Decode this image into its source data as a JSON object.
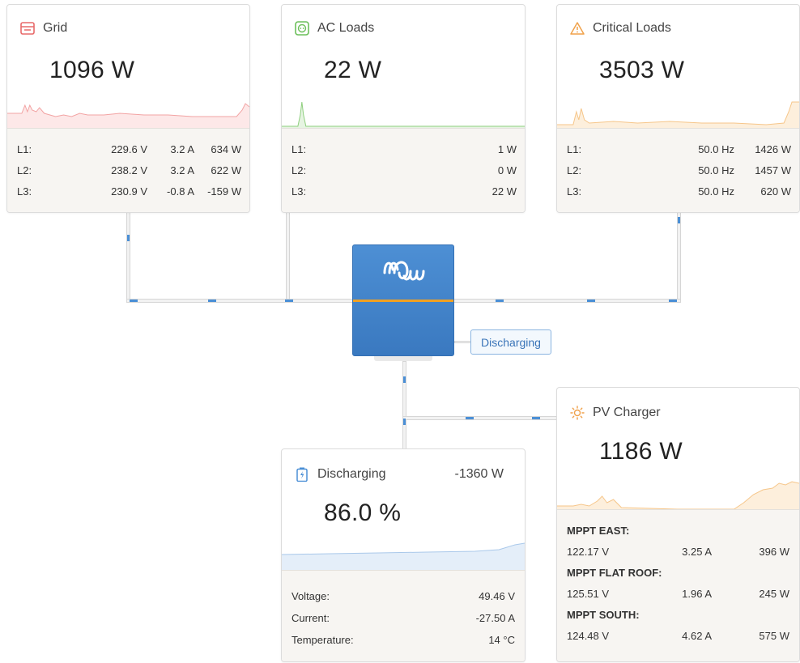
{
  "grid": {
    "title": "Grid",
    "power": "1096 W",
    "icon": "grid-icon",
    "color": "#e86a6a",
    "rows": [
      {
        "phase": "L1:",
        "voltage": "229.6 V",
        "current": "3.2 A",
        "power": "634 W"
      },
      {
        "phase": "L2:",
        "voltage": "238.2 V",
        "current": "3.2 A",
        "power": "622 W"
      },
      {
        "phase": "L3:",
        "voltage": "230.9 V",
        "current": "-0.8 A",
        "power": "-159 W"
      }
    ]
  },
  "ac_loads": {
    "title": "AC Loads",
    "power": "22 W",
    "icon": "outlet-icon",
    "color": "#6cbf5a",
    "rows": [
      {
        "phase": "L1:",
        "power": "1 W"
      },
      {
        "phase": "L2:",
        "power": "0 W"
      },
      {
        "phase": "L3:",
        "power": "22 W"
      }
    ]
  },
  "critical_loads": {
    "title": "Critical Loads",
    "power": "3503 W",
    "icon": "warning-icon",
    "color": "#f0a14a",
    "rows": [
      {
        "phase": "L1:",
        "frequency": "50.0 Hz",
        "power": "1426 W"
      },
      {
        "phase": "L2:",
        "frequency": "50.0 Hz",
        "power": "1457 W"
      },
      {
        "phase": "L3:",
        "frequency": "50.0 Hz",
        "power": "620 W"
      }
    ]
  },
  "inverter": {
    "logo": "victron-logo-icon",
    "status": "Discharging"
  },
  "battery": {
    "title": "Discharging",
    "power": "-1360 W",
    "soc": "86.0 %",
    "icon": "battery-icon",
    "color": "#4a8fd6",
    "rows": [
      {
        "label": "Voltage:",
        "value": "49.46 V"
      },
      {
        "label": "Current:",
        "value": "-27.50 A"
      },
      {
        "label": "Temperature:",
        "value": "14 °C"
      }
    ]
  },
  "pv_charger": {
    "title": "PV Charger",
    "power": "1186 W",
    "icon": "sun-icon",
    "color": "#f0a14a",
    "trackers": [
      {
        "name": "MPPT EAST:",
        "voltage": "122.17 V",
        "current": "3.25 A",
        "power": "396 W"
      },
      {
        "name": "MPPT FLAT ROOF:",
        "voltage": "125.51 V",
        "current": "1.96 A",
        "power": "245 W"
      },
      {
        "name": "MPPT SOUTH:",
        "voltage": "124.48 V",
        "current": "4.62 A",
        "power": "575 W"
      }
    ]
  }
}
